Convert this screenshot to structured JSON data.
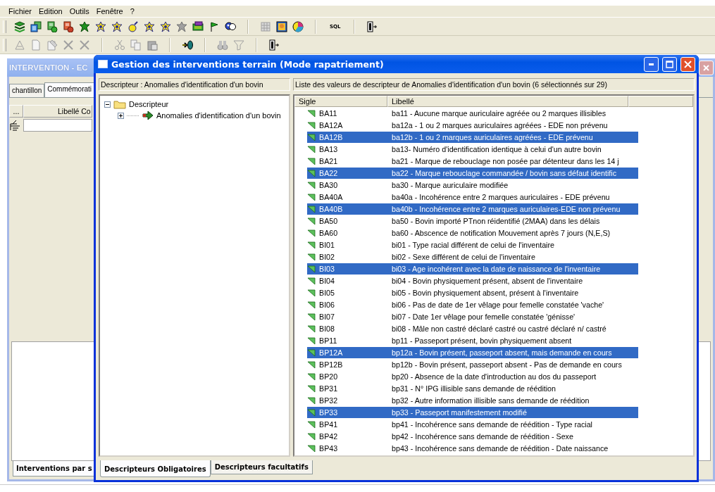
{
  "menu": [
    {
      "label": "Fichier"
    },
    {
      "label": "Edition"
    },
    {
      "label": "Outils"
    },
    {
      "label": "Fenêtre"
    },
    {
      "label": "?"
    }
  ],
  "toolbar": {
    "sql_label": "SQL"
  },
  "background_window": {
    "title": "INTERVENTION - EC",
    "tabs": [
      {
        "label": "chantillon",
        "selected": false
      },
      {
        "label": "Commémorati",
        "selected": true
      }
    ],
    "grid": {
      "column_1": "...",
      "column_2": "Libellé Co"
    },
    "bottom_tabs": [
      {
        "label": "Interventions par s",
        "selected": true
      }
    ]
  },
  "dialog": {
    "title": "Gestion des interventions terrain (Mode rapatriement)",
    "left_header": "Descripteur : Anomalies d'identification d'un bovin",
    "tree": [
      {
        "label": "Descripteur",
        "expanded": true,
        "children": [
          {
            "label": "Anomalies d'identification d'un bovin",
            "expanded": false
          }
        ]
      }
    ],
    "right_header": "Liste des valeurs de descripteur de  Anomalies d'identification d'un bovin (6 sélectionnés sur 29)",
    "columns": [
      "Sigle",
      "Libellé"
    ],
    "rows": [
      {
        "sigle": "BA11",
        "libelle": "ba11 - Aucune marque auriculaire agréée ou 2 marques illisibles",
        "selected": false
      },
      {
        "sigle": "BA12A",
        "libelle": "ba12a - 1 ou 2 marques auriculaires agréées - EDE non prévenu",
        "selected": false
      },
      {
        "sigle": "BA12B",
        "libelle": "ba12b - 1 ou 2 marques auriculaires agréées - EDE prévenu",
        "selected": true
      },
      {
        "sigle": "BA13",
        "libelle": "ba13- Numéro d'identification identique à celui d'un autre bovin",
        "selected": false
      },
      {
        "sigle": "BA21",
        "libelle": "ba21 - Marque de rebouclage non posée par détenteur dans les 14 j",
        "selected": false
      },
      {
        "sigle": "BA22",
        "libelle": "ba22 - Marque rebouclage commandée / bovin sans défaut identific",
        "selected": true
      },
      {
        "sigle": "BA30",
        "libelle": "ba30 - Marque auriculaire modifiée",
        "selected": false
      },
      {
        "sigle": "BA40A",
        "libelle": "ba40a - Incohérence entre 2 marques auriculaires - EDE prévenu",
        "selected": false
      },
      {
        "sigle": "BA40B",
        "libelle": "ba40b - Incohérence entre 2 marques auriculaires-EDE non prévenu",
        "selected": true
      },
      {
        "sigle": "BA50",
        "libelle": "ba50 - Bovin importé PTnon réidentifié (2MAA) dans les délais",
        "selected": false
      },
      {
        "sigle": "BA60",
        "libelle": "ba60 - Abscence de notification Mouvement après 7 jours (N,E,S)",
        "selected": false
      },
      {
        "sigle": "BI01",
        "libelle": "bi01 - Type racial différent de celui de l'inventaire",
        "selected": false
      },
      {
        "sigle": "BI02",
        "libelle": "bi02 - Sexe différent de celui de l'inventaire",
        "selected": false
      },
      {
        "sigle": "BI03",
        "libelle": "bi03 - Age incohérent avec la date de naissance de l'inventaire",
        "selected": true
      },
      {
        "sigle": "BI04",
        "libelle": "bi04 - Bovin physiquement présent, absent de l'inventaire",
        "selected": false
      },
      {
        "sigle": "BI05",
        "libelle": "bi05 - Bovin physiquement absent, présent à l'inventaire",
        "selected": false
      },
      {
        "sigle": "BI06",
        "libelle": "bi06 - Pas de date de 1er vêlage pour femelle constatée 'vache'",
        "selected": false
      },
      {
        "sigle": "BI07",
        "libelle": "bi07 - Date 1er vêlage pour femelle constatée 'génisse'",
        "selected": false
      },
      {
        "sigle": "BI08",
        "libelle": "bi08 - Mâle non castré déclaré castré ou castré déclaré n/ castré",
        "selected": false
      },
      {
        "sigle": "BP11",
        "libelle": "bp11 - Passeport présent, bovin physiquement absent",
        "selected": false
      },
      {
        "sigle": "BP12A",
        "libelle": "bp12a - Bovin présent, passeport absent, mais demande en cours",
        "selected": true
      },
      {
        "sigle": "BP12B",
        "libelle": "bp12b - Bovin présent, passeport absent - Pas de demande en cours",
        "selected": false
      },
      {
        "sigle": "BP20",
        "libelle": "bp20 - Absence de la date d'introduction au dos du passeport",
        "selected": false
      },
      {
        "sigle": "BP31",
        "libelle": "bp31 - N° IPG illisible sans demande de réédition",
        "selected": false
      },
      {
        "sigle": "BP32",
        "libelle": "bp32 - Autre information illisible sans demande de réédition",
        "selected": false
      },
      {
        "sigle": "BP33",
        "libelle": "bp33 - Passeport manifestement modifié",
        "selected": true
      },
      {
        "sigle": "BP41",
        "libelle": "bp41 - Incohérence sans demande de réédition - Type racial",
        "selected": false
      },
      {
        "sigle": "BP42",
        "libelle": "bp42 - Incohérence sans demande de réédition - Sexe",
        "selected": false
      },
      {
        "sigle": "BP43",
        "libelle": "bp43 - Incohérence sans demande de réédition - Date naissance",
        "selected": false
      }
    ],
    "tabs": [
      {
        "label": "Descripteurs Obligatoires",
        "selected": true
      },
      {
        "label": "Descripteurs facultatifs",
        "selected": false
      }
    ]
  }
}
